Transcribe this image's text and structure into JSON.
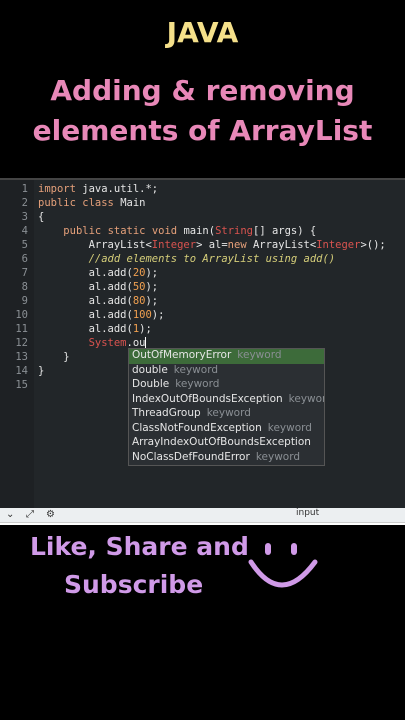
{
  "header": {
    "title": "JAVA",
    "line1": "Adding & removing",
    "line2": "elements of ArrayList"
  },
  "editor": {
    "lines": [
      "1",
      "2",
      "3",
      "4",
      "5",
      "6",
      "7",
      "8",
      "9",
      "10",
      "11",
      "12",
      "13",
      "14",
      "15"
    ]
  },
  "autocomplete": {
    "items": [
      {
        "name": "OutOfMemoryError",
        "kind": "keyword"
      },
      {
        "name": "double",
        "kind": "keyword"
      },
      {
        "name": "Double",
        "kind": "keyword"
      },
      {
        "name": "IndexOutOfBoundsException",
        "kind": "keyword"
      },
      {
        "name": "ThreadGroup",
        "kind": "keyword"
      },
      {
        "name": "ClassNotFoundException",
        "kind": "keyword"
      },
      {
        "name": "ArrayIndexOutOfBoundsException",
        "kind": ""
      },
      {
        "name": "NoClassDefFoundError",
        "kind": "keyword"
      }
    ]
  },
  "console": {
    "input_label": "input"
  },
  "footer": {
    "line1": "Like, Share and",
    "line2": "Subscribe"
  },
  "colors": {
    "title": "#f5e08a",
    "heading": "#e888b8",
    "cta": "#d09ae8",
    "editor_bg": "#222629"
  }
}
